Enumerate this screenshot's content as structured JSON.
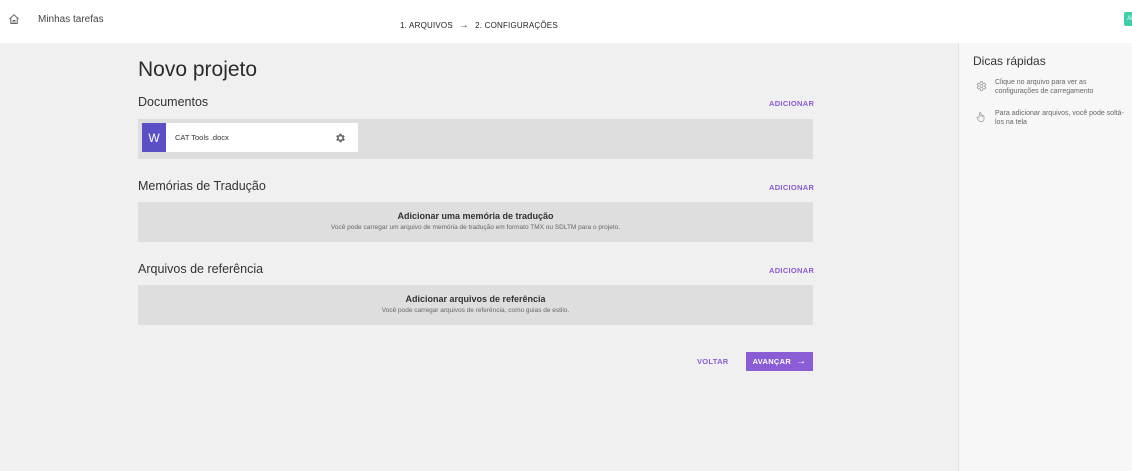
{
  "header": {
    "nav_title": "Minhas tarefas",
    "steps": [
      {
        "label": "1. ARQUIVOS"
      },
      {
        "label": "2. CONFIGURAÇÕES"
      }
    ],
    "step_arrow": "→",
    "avatar_initials": "AF"
  },
  "main": {
    "title": "Novo projeto",
    "add_label": "ADICIONAR",
    "documents": {
      "title": "Documentos",
      "files": [
        {
          "badge": "W",
          "name": "CAT Tools .docx"
        }
      ]
    },
    "translation_memories": {
      "title": "Memórias de Tradução",
      "empty_title": "Adicionar uma memória de tradução",
      "empty_subtitle": "Você pode carregar um arquivo de memória de tradução em formato TMX ou SDLTM para o projeto."
    },
    "reference_files": {
      "title": "Arquivos de referência",
      "empty_title": "Adicionar arquivos de referência",
      "empty_subtitle": "Você pode carregar arquivos de referência, como guias de estilo."
    },
    "back_label": "VOLTAR",
    "next_label": "AVANÇAR",
    "next_arrow": "→"
  },
  "tips": {
    "title": "Dicas rápidas",
    "items": [
      {
        "icon": "gear-icon",
        "text": "Clique no arquivo para ver as configurações de carregamento"
      },
      {
        "icon": "hand-pointer-icon",
        "text": "Para adicionar arquivos, você pode soltá-los na tela"
      }
    ]
  },
  "colors": {
    "accent": "#8a5cd6",
    "word_badge": "#5a4fc4",
    "avatar": "#3ecfa8"
  }
}
